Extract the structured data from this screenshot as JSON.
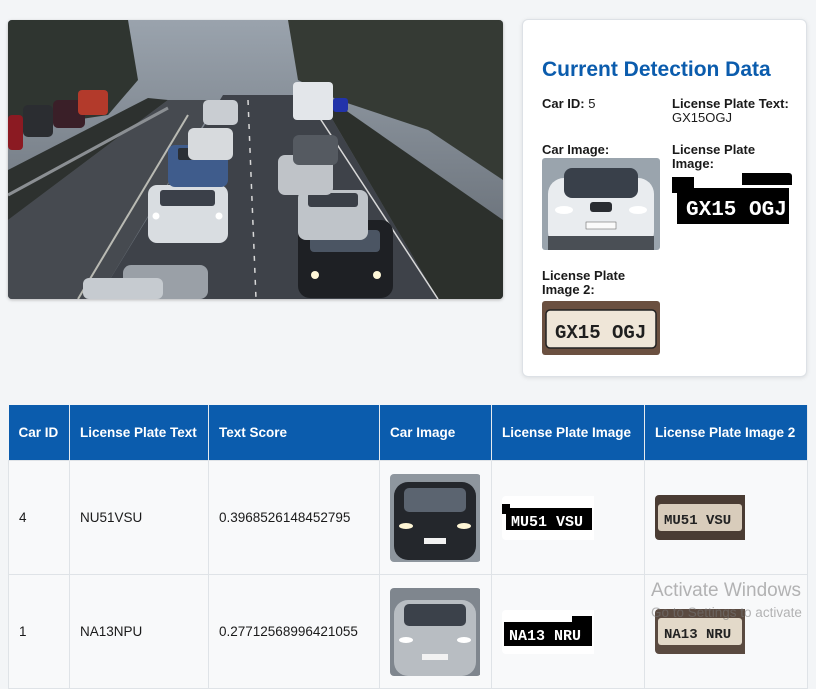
{
  "detection_panel": {
    "title": "Current Detection Data",
    "car_id_label": "Car ID:",
    "car_id_value": "5",
    "plate_text_label": "License Plate Text:",
    "plate_text_value": "GX15OGJ",
    "car_image_label": "Car Image:",
    "plate_image_label": "License Plate Image:",
    "plate_image2_label": "License Plate Image 2:",
    "plate_binary_text": "GX15 OGJ",
    "plate_photo_text": "GX15 OGJ"
  },
  "table": {
    "headers": [
      "Car ID",
      "License Plate Text",
      "Text Score",
      "Car Image",
      "License Plate Image",
      "License Plate Image 2"
    ],
    "rows": [
      {
        "car_id": "4",
        "plate_text": "NU51VSU",
        "text_score": "0.3968526148452795",
        "binary_plate": "MU51 VSU",
        "photo_plate": "MU51 VSU"
      },
      {
        "car_id": "1",
        "plate_text": "NA13NPU",
        "text_score": "0.27712568996421055",
        "binary_plate": "NA13 NRU",
        "photo_plate": "NA13 NRU"
      }
    ]
  },
  "watermark": {
    "line1": "Activate Windows",
    "line2": "Go to Settings to activate"
  }
}
